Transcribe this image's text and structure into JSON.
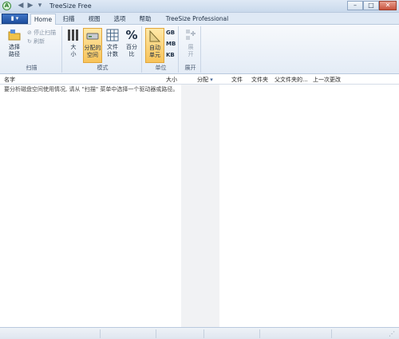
{
  "window": {
    "title": "TreeSize Free",
    "app_icon": "A",
    "controls": {
      "minimize": "–",
      "maximize": "□",
      "close": "✕"
    }
  },
  "quick_access": {
    "back": "◀",
    "forward": "▶",
    "dropdown": "▾"
  },
  "ribbon_tabs": {
    "file": "▮ ▾",
    "items": [
      "Home",
      "扫描",
      "视图",
      "选项",
      "帮助",
      "TreeSize Professional"
    ],
    "active": "Home"
  },
  "ribbon": {
    "scan_group": {
      "choose_path": "选择",
      "choose_path_2": "路径",
      "stop_scan": "停止扫描",
      "refresh": "刷新",
      "label": "扫描"
    },
    "mode_group": {
      "size": "大",
      "size_2": "小",
      "allocated": "分配的",
      "allocated_2": "空间",
      "file_count": "文件",
      "file_count_2": "计数",
      "percent": "百分",
      "percent_2": "比",
      "percent_symbol": "%",
      "label": "模式"
    },
    "unit_group": {
      "auto": "自动",
      "auto_2": "单元",
      "gb": "GB",
      "mb": "MB",
      "kb": "KB",
      "label": "单位"
    },
    "expand_group": {
      "expand": "展",
      "expand_2": "开",
      "label": "展开"
    }
  },
  "columns": {
    "name": "名字",
    "size": "大小",
    "allocated": "分配",
    "files": "文件",
    "folders": "文件夹",
    "parent": "父文件夹的...",
    "last_modified": "上一次更改"
  },
  "hint_text": "要分析磁盘空间使用情况, 请从 \"扫描\" 菜单中选择一个驱动器或路径。",
  "colors": {
    "accent": "#1e4f9e",
    "active_button": "#f7c35a",
    "ribbon_bg": "#e4ecf6"
  }
}
